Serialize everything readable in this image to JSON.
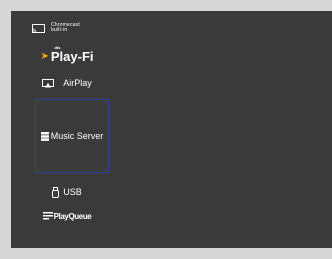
{
  "sources": {
    "chromecast": {
      "line1": "Chromecast",
      "line2": "built-in",
      "icon": "cast-icon"
    },
    "playfi": {
      "super": "dts",
      "label": "Play-Fi",
      "icon": "play-fi-arrow-icon",
      "accent": "#f2a900"
    },
    "airplay": {
      "label": "AirPlay",
      "icon": "airplay-icon"
    },
    "music_server": {
      "label": "Music Server",
      "icon": "server-icon",
      "selected": true,
      "selection_color": "#2f3f9a"
    },
    "usb": {
      "label": "USB",
      "icon": "usb-icon"
    },
    "play_queue": {
      "label": "PlayQueue",
      "icon": "queue-icon"
    }
  },
  "colors": {
    "screen_bg": "#3a3a3a",
    "frame_bg": "#d6d6d6",
    "text": "#ffffff"
  }
}
